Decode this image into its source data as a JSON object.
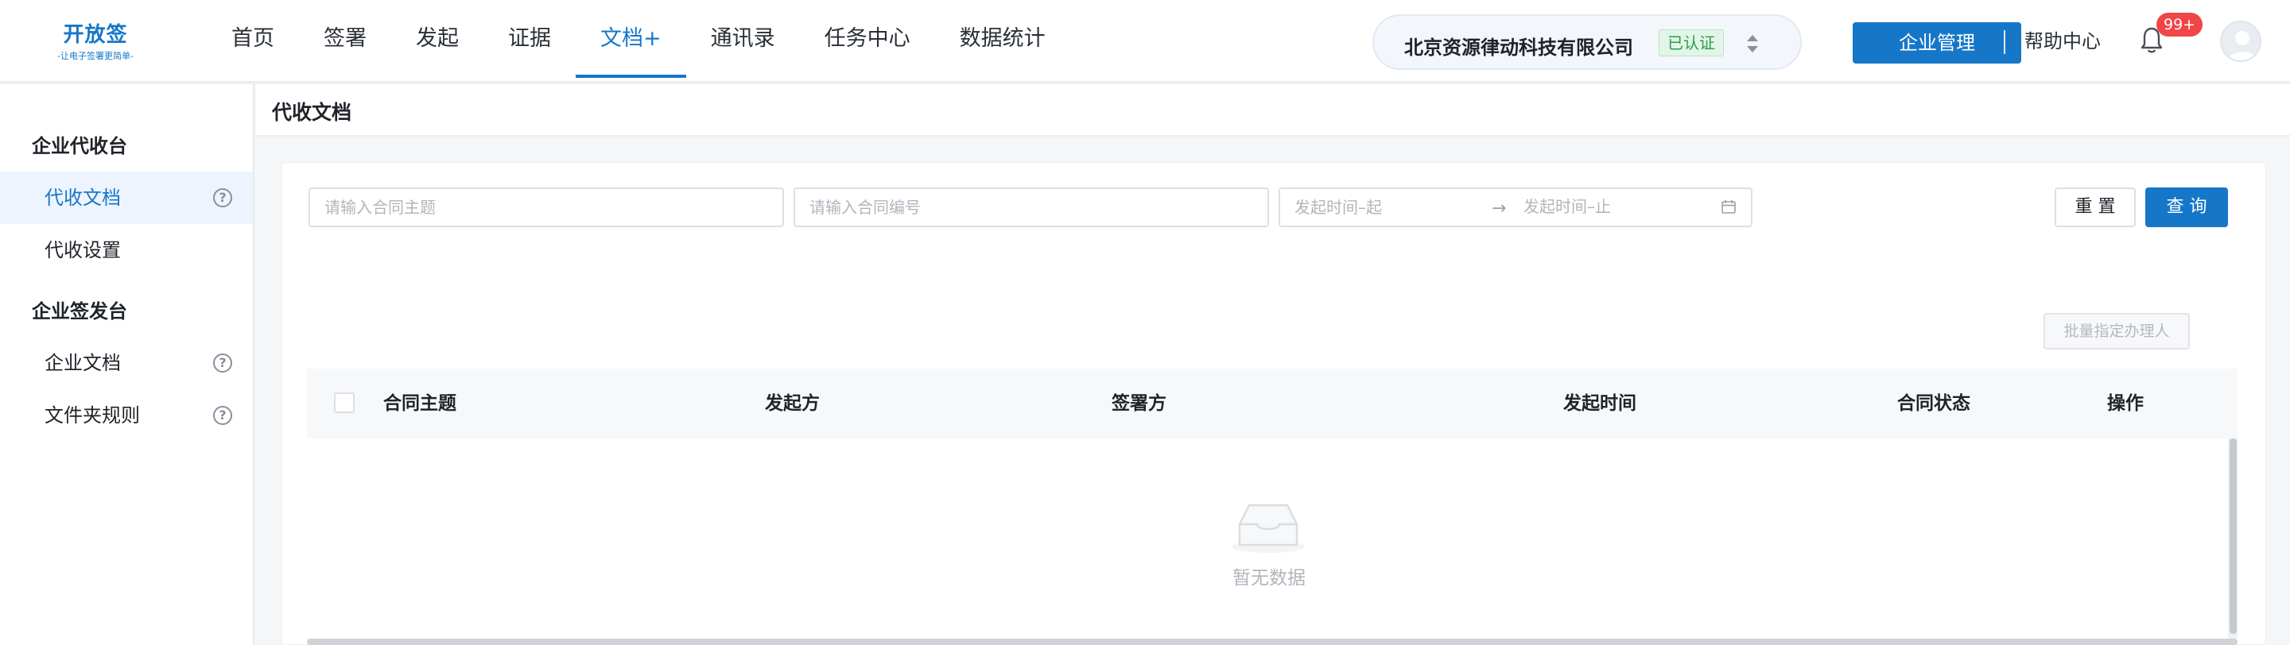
{
  "logo": {
    "title": "开放签",
    "subtitle": "-让电子签署更简单-"
  },
  "nav": [
    {
      "label": "首页"
    },
    {
      "label": "签署"
    },
    {
      "label": "发起"
    },
    {
      "label": "证据"
    },
    {
      "label": "文档+"
    },
    {
      "label": "通讯录"
    },
    {
      "label": "任务中心"
    },
    {
      "label": "数据统计"
    }
  ],
  "company": {
    "name": "北京资源律动科技有限公司",
    "badge": "已认证"
  },
  "header": {
    "manage_label": "企业管理",
    "help_label": "帮助中心",
    "notification_count": "99+"
  },
  "sidebar": {
    "group1": "企业代收台",
    "item1": "代收文档",
    "item2": "代收设置",
    "group2": "企业签发台",
    "item3": "企业文档",
    "item4": "文件夹规则"
  },
  "page": {
    "title": "代收文档"
  },
  "filters": {
    "subject_placeholder": "请输入合同主题",
    "number_placeholder": "请输入合同编号",
    "date_start_placeholder": "发起时间–起",
    "date_end_placeholder": "发起时间–止",
    "reset_label": "重 置",
    "query_label": "查 询"
  },
  "batch_label": "批量指定办理人",
  "table": {
    "columns": [
      "合同主题",
      "发起方",
      "签署方",
      "发起时间",
      "合同状态",
      "操作"
    ],
    "empty_text": "暂无数据"
  },
  "colors": {
    "accent": "#1677c9",
    "badge_red": "#f04646",
    "verified_green": "#2a9d4a"
  }
}
